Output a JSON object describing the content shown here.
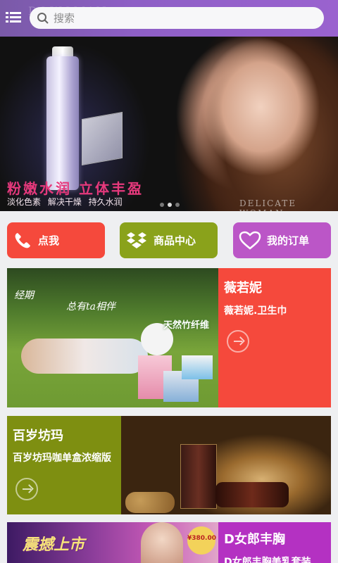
{
  "search": {
    "placeholder": "搜索"
  },
  "banner": {
    "slogan": "粉嫩水润 立体丰盈",
    "tags": "淡化色素 解决干燥 持久水润",
    "brand_text": "DELICATE WOMAN",
    "watermark": "D&WOMAN",
    "slide_count": 3,
    "active_slide": 2
  },
  "quick_actions": [
    {
      "label": "点我",
      "icon": "phone-icon",
      "color": "#f5493c"
    },
    {
      "label": "商品中心",
      "icon": "dropbox-icon",
      "color": "#8aa21b"
    },
    {
      "label": "我的订单",
      "icon": "heart-icon",
      "color": "#bb56c7"
    }
  ],
  "promos": [
    {
      "title": "薇若妮",
      "subtitle": "薇若妮.卫生巾",
      "color": "#f5493c",
      "image_text": {
        "line1": "经期",
        "line2": "总有ta相伴",
        "line3": "天然竹纤维"
      }
    },
    {
      "title": "百岁坊玛",
      "subtitle": "百岁坊玛咖单盒浓缩版",
      "color": "#7e8f11"
    },
    {
      "title": "D女郎丰胸",
      "subtitle": "D女郎丰胸美乳套装",
      "color": "#b431c2",
      "image_text": {
        "headline": "震撼上市",
        "price": "¥380.00"
      }
    }
  ]
}
